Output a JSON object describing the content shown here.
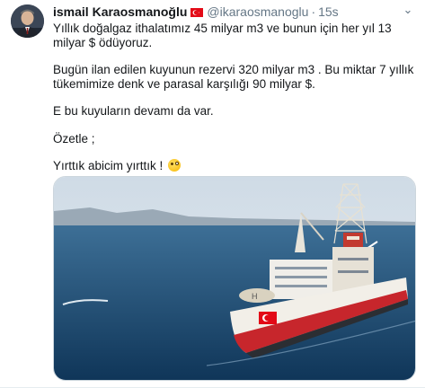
{
  "tweet": {
    "author_name": "ismail Karaosmanoğlu",
    "handle": "@ikaraosmanoglu",
    "separator": "·",
    "time": "15s",
    "more_glyph": "⌄",
    "paragraphs": [
      "Yıllık doğalgaz ithalatımız 45 milyar m3 ve bunun için her yıl 13 milyar $ ödüyoruz.",
      "Bugün ilan edilen kuyunun rezervi 320 milyar m3 . Bu miktar 7 yıllık tükemimize denk ve parasal karşılığı 90 milyar $.",
      "E bu kuyuların devamı da var.",
      "Özetle ;",
      "Yırttık abicim yırttık !"
    ],
    "emoji": "zany-face-emoji",
    "flag": "turkey-flag-icon",
    "media": "drillship-photo"
  },
  "colors": {
    "text": "#14171a",
    "muted": "#657786",
    "border": "#e6ecf0",
    "flag_red": "#e30a17"
  }
}
